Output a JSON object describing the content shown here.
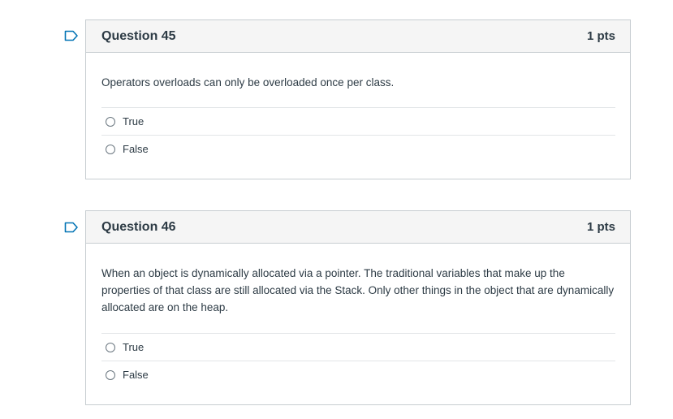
{
  "questions": [
    {
      "title": "Question 45",
      "points": "1 pts",
      "text": "Operators overloads can only be overloaded once per class.",
      "answers": [
        "True",
        "False"
      ]
    },
    {
      "title": "Question 46",
      "points": "1 pts",
      "text": "When an object is dynamically allocated via a pointer.  The traditional variables that make up the properties of that class are still allocated via the Stack.  Only other things in the object that are dynamically allocated are on the heap.",
      "answers": [
        "True",
        "False"
      ]
    }
  ],
  "colors": {
    "flag": "#0374b5",
    "border": "#c7cdd1",
    "header_bg": "#f5f5f5",
    "text": "#2d3b45"
  },
  "icons": {
    "flag": "bookmark-flag-icon"
  }
}
